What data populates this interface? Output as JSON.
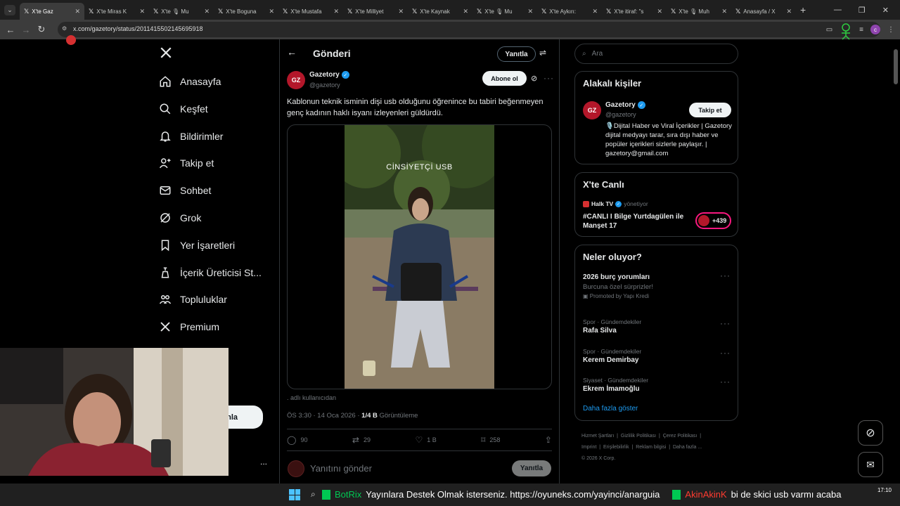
{
  "browser": {
    "tabs": [
      {
        "label": "X'te Gaz"
      },
      {
        "label": "X'te Miras K"
      },
      {
        "label": "X'te 🎙 Mu"
      },
      {
        "label": "X'te Boguna"
      },
      {
        "label": "X'te Mustafa"
      },
      {
        "label": "X'te Milliyet"
      },
      {
        "label": "X'te Kaynak"
      },
      {
        "label": "X'te 🎙 Mu"
      },
      {
        "label": "X'te Aykırı:"
      },
      {
        "label": "X'te itiraf: \"s"
      },
      {
        "label": "X'te 🎙 Muh"
      },
      {
        "label": "Anasayfa / X"
      }
    ],
    "url": "x.com/gazetory/status/2011415502145695918"
  },
  "sidebar": {
    "items": [
      {
        "label": "Anasayfa",
        "icon": "home-icon"
      },
      {
        "label": "Keşfet",
        "icon": "search-icon"
      },
      {
        "label": "Bildirimler",
        "icon": "bell-icon"
      },
      {
        "label": "Takip et",
        "icon": "follow-icon"
      },
      {
        "label": "Sohbet",
        "icon": "mail-icon"
      },
      {
        "label": "Grok",
        "icon": "grok-icon"
      },
      {
        "label": "Yer İşaretleri",
        "icon": "bookmark-icon"
      },
      {
        "label": "İçerik Üreticisi St...",
        "icon": "creator-icon"
      },
      {
        "label": "Topluluklar",
        "icon": "communities-icon"
      },
      {
        "label": "Premium",
        "icon": "x-logo-icon"
      }
    ],
    "post_button_partial": "nla",
    "more_dots": "..."
  },
  "main": {
    "header_title": "Gönderi",
    "reply_label": "Yanıtla",
    "author_name": "Gazetory",
    "author_handle": "@gazetory",
    "avatar_text": "GZ",
    "subscribe_label": "Abone ol",
    "tweet_text": "Kablonun teknik isminin dişi usb olduğunu öğrenince bu tabiri beğenmeyen genç kadının haklı isyanı izleyenleri güldürdü.",
    "video_caption": "CİNSİYETÇİ USB",
    "credit": ". adlı kullanıcıdan",
    "time": "ÖS 3:30 · 14 Oca 2026 · ",
    "views": "1/4 B",
    "views_label": " Görüntüleme",
    "stats": {
      "replies": "90",
      "reposts": "29",
      "likes": "1 B",
      "bookmarks": "258"
    },
    "reply_placeholder": "Yanıtını gönder",
    "reply_button": "Yanıtla"
  },
  "right": {
    "search_placeholder": "Ara",
    "relevant": {
      "title": "Alakalı kişiler",
      "name": "Gazetory",
      "handle": "@gazetory",
      "follow": "Takip et",
      "bio": "🎙️Dijital Haber ve Viral İçerikler | Gazetory dijital medyayı tarar, sıra dışı haber ve popüler içerikleri sizlerle paylaşır. | gazetory@gmail.com"
    },
    "live": {
      "title": "X'te Canlı",
      "host": "Halk TV",
      "host_status": "yönetiyor",
      "stream_title": "#CANLI I Bilge Yurtdagülen ile Manşet 17",
      "listeners": "+439"
    },
    "trends": {
      "title": "Neler oluyor?",
      "items": [
        {
          "category": "",
          "name": "2026 burç yorumları",
          "sub": "Burcuna özel sürprizler!",
          "promo": "Promoted by Yapı Kredi"
        },
        {
          "category": "Spor · Gündemdekiler",
          "name": "Rafa Silva",
          "sub": "",
          "promo": ""
        },
        {
          "category": "Spor · Gündemdekiler",
          "name": "Kerem Demirbay",
          "sub": "",
          "promo": ""
        },
        {
          "category": "Siyaset · Gündemdekiler",
          "name": "Ekrem İmamoğlu",
          "sub": "",
          "promo": ""
        }
      ],
      "more": "Daha fazla göster"
    },
    "footer": [
      "Hizmet Şartları",
      "Gizlilik Politikası",
      "Çerez Politikası",
      "Imprint",
      "Erişilebilirlik",
      "Reklam bilgisi",
      "Daha fazla ...",
      "© 2026 X Corp."
    ]
  },
  "taskbar": {
    "ticker_1_name": "BotRix",
    "ticker_1_text": "Yayınlara Destek Olmak isterseniz. https://oyuneks.com/yayinci/anarguia",
    "ticker_2_name": "AkinAkinK",
    "ticker_2_text": "bi de skici usb varmı acaba",
    "clock": "17:10"
  },
  "colors": {
    "verified": "#1d9bf0",
    "accent_green": "#00c853",
    "pink": "#f91880",
    "brand_red": "#b3172a"
  }
}
